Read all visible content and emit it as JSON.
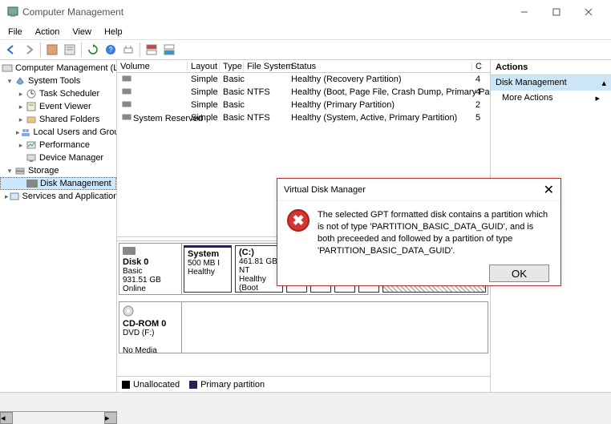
{
  "window": {
    "title": "Computer Management"
  },
  "menu": {
    "file": "File",
    "action": "Action",
    "view": "View",
    "help": "Help"
  },
  "tree": {
    "root": "Computer Management (Local",
    "systools": "System Tools",
    "task": "Task Scheduler",
    "event": "Event Viewer",
    "shared": "Shared Folders",
    "users": "Local Users and Groups",
    "perf": "Performance",
    "devmgr": "Device Manager",
    "storage": "Storage",
    "diskmgmt": "Disk Management",
    "services": "Services and Applications"
  },
  "vol": {
    "hdr": {
      "volume": "Volume",
      "layout": "Layout",
      "type": "Type",
      "fs": "File System",
      "status": "Status",
      "c": "C"
    },
    "rows": [
      {
        "name": " ",
        "layout": "Simple",
        "type": "Basic",
        "fs": "",
        "status": "Healthy (Recovery Partition)",
        "c": "4"
      },
      {
        "name": " ",
        "layout": "Simple",
        "type": "Basic",
        "fs": "NTFS",
        "status": "Healthy (Boot, Page File, Crash Dump, Primary Partition)",
        "c": "4"
      },
      {
        "name": " ",
        "layout": "Simple",
        "type": "Basic",
        "fs": "",
        "status": "Healthy (Primary Partition)",
        "c": "2"
      },
      {
        "name": "System Reserved",
        "layout": "Simple",
        "type": "Basic",
        "fs": "NTFS",
        "status": "Healthy (System, Active, Primary Partition)",
        "c": "5"
      }
    ]
  },
  "disks": {
    "d0": {
      "title": "Disk 0",
      "type": "Basic",
      "size": "931.51 GB",
      "status": "Online"
    },
    "p_sys": {
      "title": "System",
      "l2": "500 MB I",
      "l3": "Healthy"
    },
    "p_c": {
      "title": "(C:)",
      "l2": "461.81 GB NT",
      "l3": "Healthy (Boot"
    },
    "cd": {
      "title": "CD-ROM 0",
      "drive": "DVD (F:)",
      "status": "No Media"
    }
  },
  "legend": {
    "unalloc": "Unallocated",
    "primary": "Primary partition"
  },
  "actions": {
    "title": "Actions",
    "dm": "Disk Management",
    "more": "More Actions"
  },
  "dialog": {
    "title": "Virtual Disk Manager",
    "msg": "The selected GPT formatted disk contains a partition which is not of type  'PARTITION_BASIC_DATA_GUID', and is both preceeded and followed by a partition  of type 'PARTITION_BASIC_DATA_GUID'.",
    "ok": "OK"
  }
}
